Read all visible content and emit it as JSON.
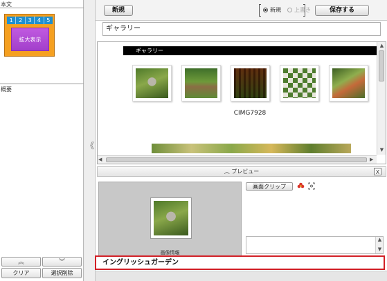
{
  "left": {
    "section1_label": "本文",
    "tabs": [
      "1",
      "2",
      "3",
      "4",
      "5"
    ],
    "enlarge_label": "拡大表示",
    "section2_label": "概要",
    "up_label": "︽",
    "down_label": "︾",
    "clear_label": "クリア",
    "delete_label": "選択削除"
  },
  "splitter": {
    "arrow": "《"
  },
  "toolbar": {
    "new_label": "新規",
    "radio_new": "新規",
    "radio_overwrite": "上書き",
    "save_label": "保存する"
  },
  "title_field": {
    "value": "ギャラリー"
  },
  "preview": {
    "gallery_bar": "ギャラリー",
    "caption": "CIMG7928"
  },
  "preview_header": {
    "label": "︿ プレビュー",
    "close": "X"
  },
  "image_panel": {
    "info_label": "画像情報",
    "clip_button": "画面クリップ"
  },
  "name_field": {
    "value": "イングリッシュガーデン"
  }
}
